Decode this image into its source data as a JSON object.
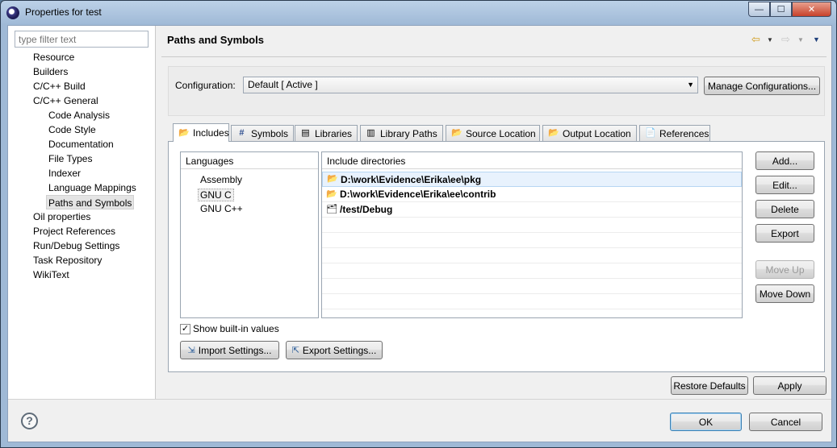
{
  "window": {
    "title": "Properties for test",
    "controls": {
      "minimize": "—",
      "maximize": "☐",
      "close": "✕"
    }
  },
  "filter": {
    "placeholder": "type filter text"
  },
  "tree": [
    {
      "label": "Resource",
      "level": 0
    },
    {
      "label": "Builders",
      "level": 0
    },
    {
      "label": "C/C++ Build",
      "level": 0
    },
    {
      "label": "C/C++ General",
      "level": 0
    },
    {
      "label": "Code Analysis",
      "level": 1
    },
    {
      "label": "Code Style",
      "level": 1
    },
    {
      "label": "Documentation",
      "level": 1
    },
    {
      "label": "File Types",
      "level": 1
    },
    {
      "label": "Indexer",
      "level": 1
    },
    {
      "label": "Language Mappings",
      "level": 1
    },
    {
      "label": "Paths and Symbols",
      "level": 1,
      "selected": true
    },
    {
      "label": "Oil properties",
      "level": 0
    },
    {
      "label": "Project References",
      "level": 0
    },
    {
      "label": "Run/Debug Settings",
      "level": 0
    },
    {
      "label": "Task Repository",
      "level": 0
    },
    {
      "label": "WikiText",
      "level": 0
    }
  ],
  "page": {
    "title": "Paths and Symbols"
  },
  "configuration": {
    "label": "Configuration:",
    "value": "Default  [ Active ]",
    "manage_label": "Manage Configurations..."
  },
  "tabs": [
    {
      "label": "Includes",
      "icon": "includes-icon",
      "active": true
    },
    {
      "label": "Symbols",
      "icon": "hash-icon"
    },
    {
      "label": "Libraries",
      "icon": "libraries-icon"
    },
    {
      "label": "Library Paths",
      "icon": "library-paths-icon"
    },
    {
      "label": "Source Location",
      "icon": "folder-icon"
    },
    {
      "label": "Output Location",
      "icon": "folder-icon"
    },
    {
      "label": "References",
      "icon": "references-icon"
    }
  ],
  "languages": {
    "header": "Languages",
    "items": [
      {
        "label": "Assembly"
      },
      {
        "label": "GNU C",
        "selected": true
      },
      {
        "label": "GNU C++"
      }
    ]
  },
  "includes": {
    "header": "Include directories",
    "items": [
      {
        "path": "D:\\work\\Evidence\\Erika\\ee\\pkg",
        "icon": "include-folder-icon",
        "selected": true
      },
      {
        "path": "D:\\work\\Evidence\\Erika\\ee\\contrib",
        "icon": "include-folder-icon"
      },
      {
        "path": "/test/Debug",
        "icon": "workspace-folder-icon"
      }
    ]
  },
  "side_buttons": {
    "add": "Add...",
    "edit": "Edit...",
    "delete": "Delete",
    "export": "Export",
    "move_up": "Move Up",
    "move_down": "Move Down"
  },
  "show_builtin": {
    "label": "Show built-in values",
    "checked": true
  },
  "import_label": "Import Settings...",
  "export_settings_label": "Export Settings...",
  "restore_label": "Restore Defaults",
  "apply_label": "Apply",
  "ok_label": "OK",
  "cancel_label": "Cancel",
  "help_icon_text": "?"
}
